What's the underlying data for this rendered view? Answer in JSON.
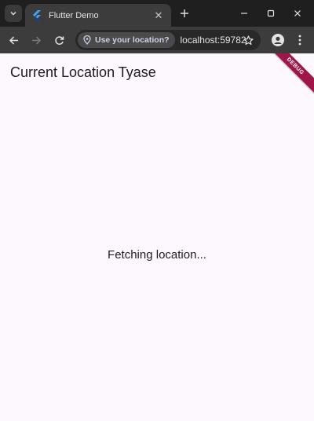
{
  "browser": {
    "tab": {
      "title": "Flutter Demo",
      "favicon": "flutter-logo-icon"
    },
    "window_controls": [
      "minimize-icon",
      "maximize-icon",
      "close-icon"
    ],
    "toolbar": {
      "location_chip": "Use your location?",
      "url": "localhost:59782"
    }
  },
  "app": {
    "title": "Current Location Tyase",
    "status": "Fetching location...",
    "debug_banner": "DEBUG",
    "background_color": "#fdf7fe",
    "banner_color": "#a0154a"
  }
}
